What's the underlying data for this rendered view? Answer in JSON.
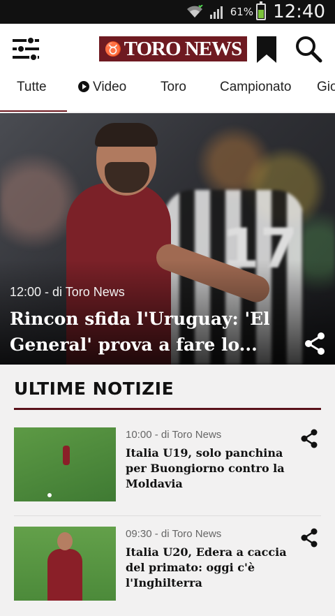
{
  "status_bar": {
    "battery_pct": "61%",
    "battery_level": 0.61,
    "time": "12:40"
  },
  "app": {
    "logo_text": "TORO NEWS",
    "brand_color": "#6e1a21"
  },
  "tabs": [
    {
      "label": "Tutte",
      "active": true
    },
    {
      "label": "Video",
      "icon": "play-icon"
    },
    {
      "label": "Toro"
    },
    {
      "label": "Campionato"
    },
    {
      "label": "Gio"
    }
  ],
  "hero": {
    "meta": "12:00 - di Toro News",
    "title": "Rincon sfida l'Uruguay: 'El General' prova a fare lo...",
    "jersey_number": "17"
  },
  "section": {
    "title": "ULTIME NOTIZIE"
  },
  "news": [
    {
      "meta": "10:00 - di Toro News",
      "headline": "Italia U19, solo panchina per Buongiorno contro la Moldavia"
    },
    {
      "meta": "09:30 - di Toro News",
      "headline": "Italia U20, Edera a caccia del primato: oggi c'è l'Inghilterra"
    }
  ]
}
